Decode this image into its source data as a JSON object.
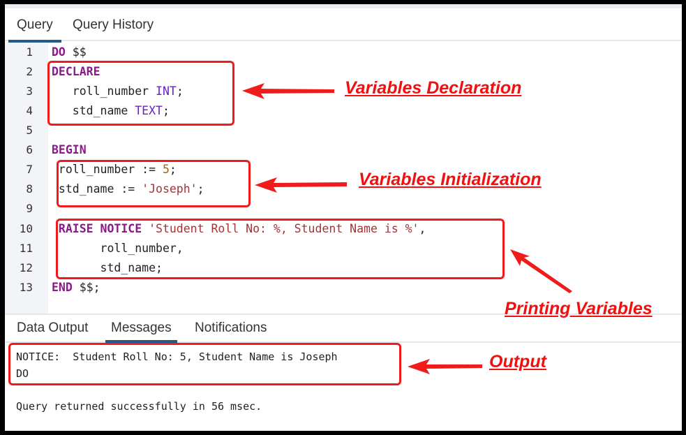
{
  "editor_tabs": [
    {
      "label": "Query",
      "active": true
    },
    {
      "label": "Query History",
      "active": false
    }
  ],
  "code_lines": [
    {
      "num": "1"
    },
    {
      "num": "2"
    },
    {
      "num": "3"
    },
    {
      "num": "4"
    },
    {
      "num": "5"
    },
    {
      "num": "6"
    },
    {
      "num": "7"
    },
    {
      "num": "8"
    },
    {
      "num": "9"
    },
    {
      "num": "10"
    },
    {
      "num": "11"
    },
    {
      "num": "12"
    },
    {
      "num": "13"
    }
  ],
  "code": {
    "l1_kw": "DO",
    "l1_rest": " $$",
    "l2_kw": "DECLARE",
    "l3_ident": "   roll_number ",
    "l3_type": "INT",
    "l3_end": ";",
    "l4_ident": "   std_name ",
    "l4_type": "TEXT",
    "l4_end": ";",
    "l6_kw": "BEGIN",
    "l7_ident": " roll_number := ",
    "l7_num": "5",
    "l7_end": ";",
    "l8_ident": " std_name := ",
    "l8_str": "'Joseph'",
    "l8_end": ";",
    "l10_kw": " RAISE NOTICE",
    "l10_str": " 'Student Roll No: %, Student Name is %'",
    "l10_end": ",",
    "l11": "       roll_number,",
    "l12": "       std_name;",
    "l13_kw": "END",
    "l13_rest": " $$;"
  },
  "output_tabs": [
    {
      "label": "Data Output",
      "active": false
    },
    {
      "label": "Messages",
      "active": true
    },
    {
      "label": "Notifications",
      "active": false
    }
  ],
  "messages": {
    "notice": "NOTICE:  Student Roll No: 5, Student Name is Joseph",
    "do": "DO",
    "status": "Query returned successfully in 56 msec."
  },
  "annotations": {
    "declaration": "Variables Declaration",
    "initialization": "Variables Initialization",
    "printing": "Printing Variables",
    "output": "Output",
    "color": "#f01c1c"
  }
}
